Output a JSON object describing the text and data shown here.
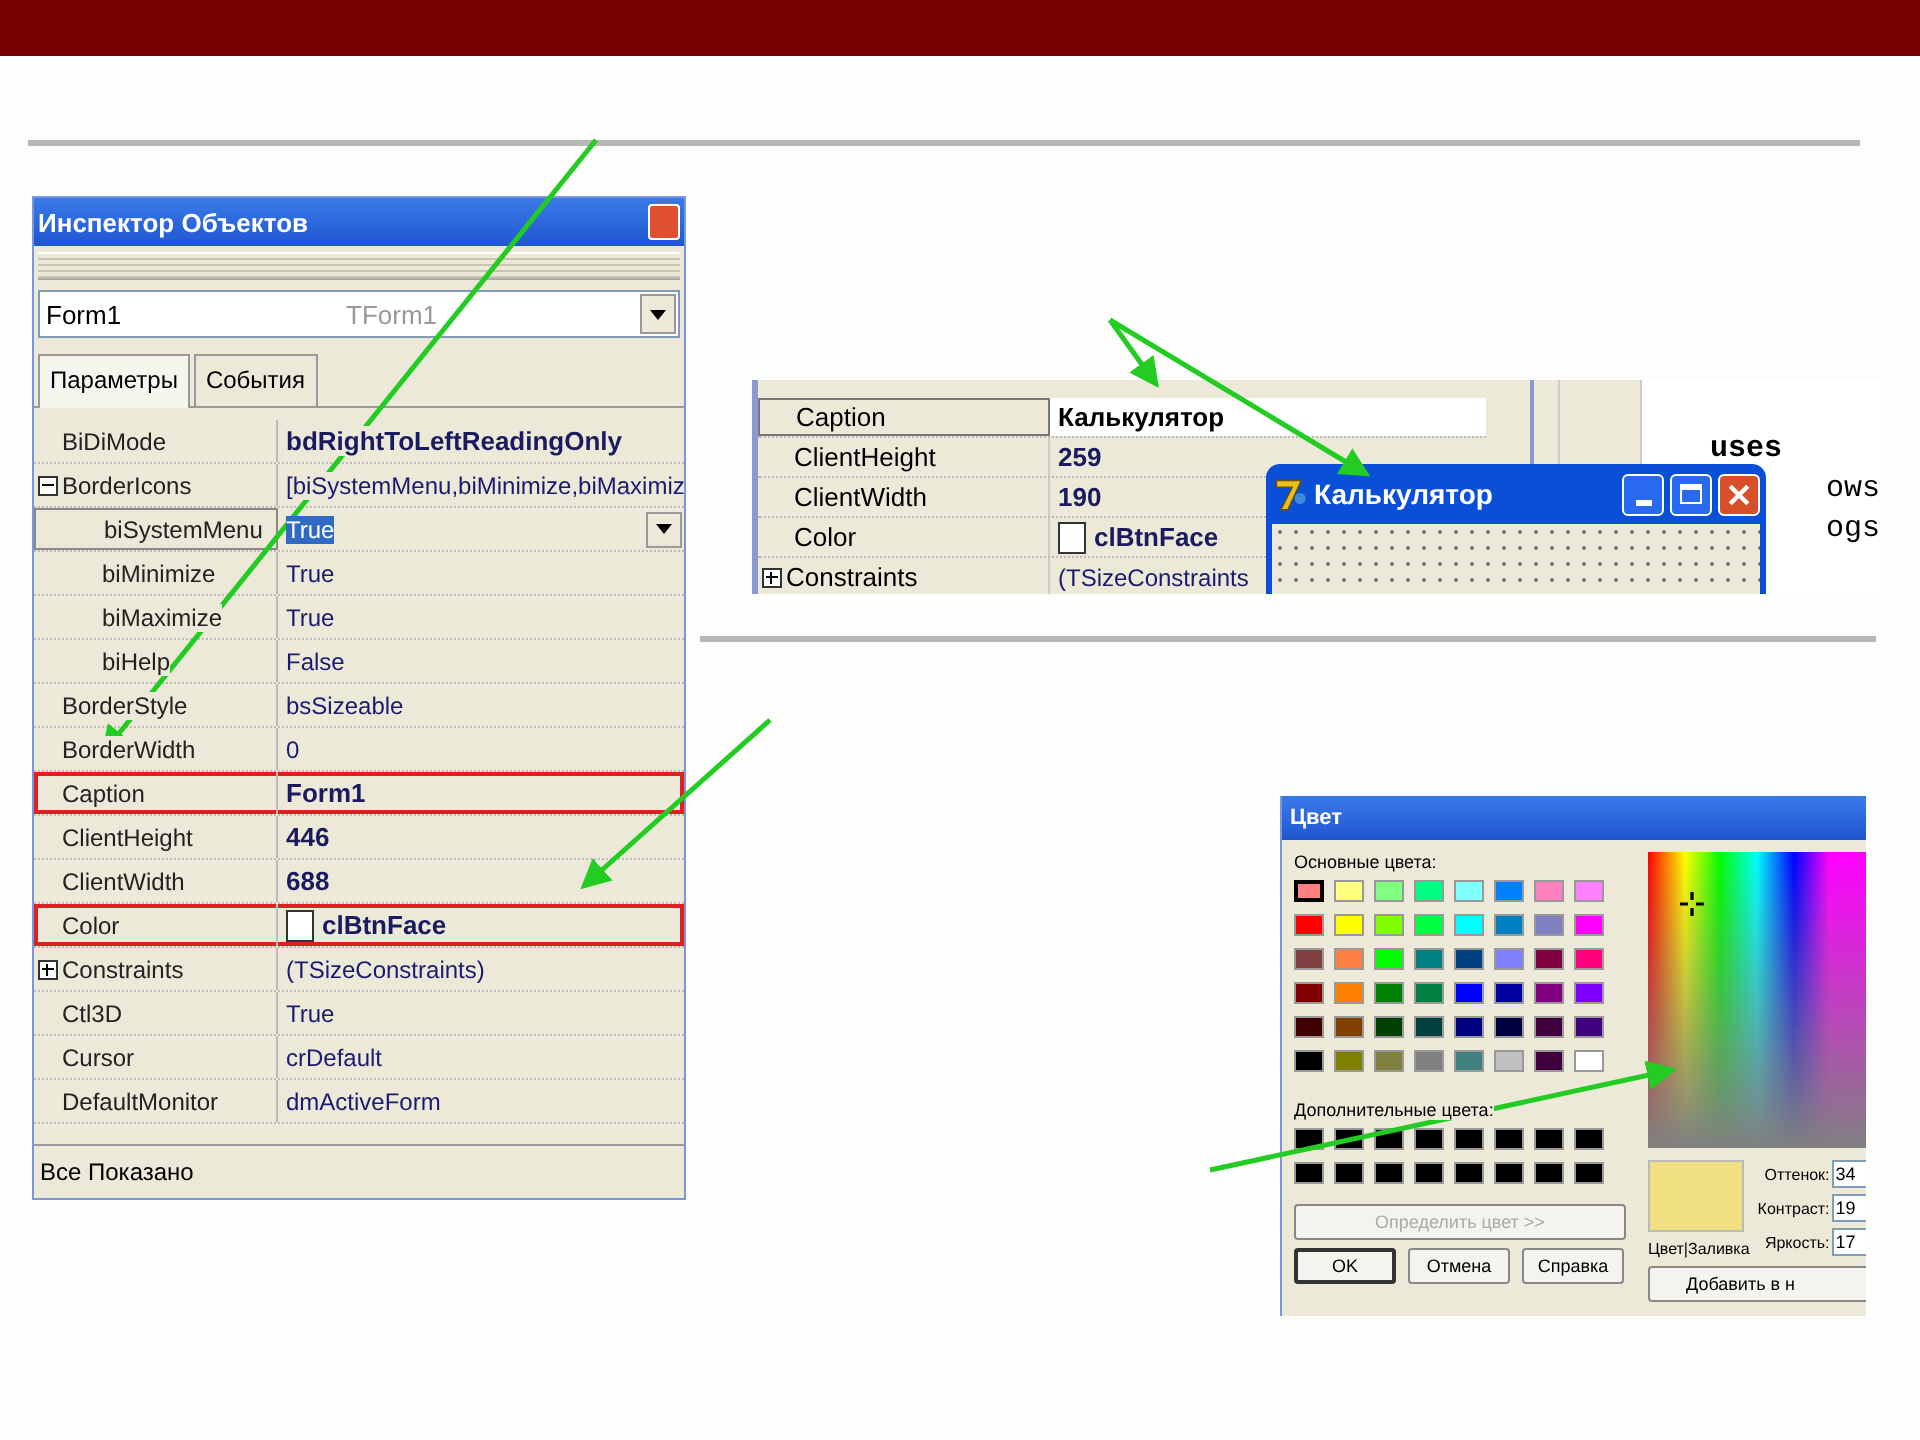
{
  "inspector": {
    "title": "Инспектор Объектов",
    "object_name": "Form1",
    "object_type": "TForm1",
    "tabs": [
      {
        "label": "Параметры",
        "selected": true
      },
      {
        "label": "События",
        "selected": false
      }
    ],
    "properties": [
      {
        "name": "BiDiMode",
        "value": "bdRightToLeftReadingOnly",
        "kind": "text",
        "bold": true,
        "selected": false,
        "highlighted": false
      },
      {
        "name": "BorderIcons",
        "value": "[biSystemMenu,biMinimize,biMaximiz",
        "kind": "text",
        "bold": false,
        "selected": false,
        "highlighted": false,
        "expanded": true,
        "children": [
          {
            "name": "biSystemMenu",
            "value": "True",
            "kind": "dropdown",
            "bold": false,
            "selected": true,
            "highlighted": false
          },
          {
            "name": "biMinimize",
            "value": "True",
            "kind": "text",
            "bold": false,
            "selected": false,
            "highlighted": false
          },
          {
            "name": "biMaximize",
            "value": "True",
            "kind": "text",
            "bold": false,
            "selected": false,
            "highlighted": false
          },
          {
            "name": "biHelp",
            "value": "False",
            "kind": "text",
            "bold": false,
            "selected": false,
            "highlighted": false
          }
        ]
      },
      {
        "name": "BorderStyle",
        "value": "bsSizeable",
        "kind": "text",
        "bold": false,
        "selected": false,
        "highlighted": false
      },
      {
        "name": "BorderWidth",
        "value": "0",
        "kind": "text",
        "bold": false,
        "selected": false,
        "highlighted": false
      },
      {
        "name": "Caption",
        "value": "Form1",
        "kind": "text",
        "bold": true,
        "selected": false,
        "highlighted": true
      },
      {
        "name": "ClientHeight",
        "value": "446",
        "kind": "text",
        "bold": true,
        "selected": false,
        "highlighted": false
      },
      {
        "name": "ClientWidth",
        "value": "688",
        "kind": "text",
        "bold": true,
        "selected": false,
        "highlighted": false
      },
      {
        "name": "Color",
        "value": "clBtnFace",
        "kind": "color",
        "bold": true,
        "selected": false,
        "highlighted": true
      },
      {
        "name": "Constraints",
        "value": "(TSizeConstraints)",
        "kind": "text",
        "bold": false,
        "selected": false,
        "highlighted": false,
        "expanded": false
      },
      {
        "name": "Ctl3D",
        "value": "True",
        "kind": "text",
        "bold": false,
        "selected": false,
        "highlighted": false
      },
      {
        "name": "Cursor",
        "value": "crDefault",
        "kind": "text",
        "bold": false,
        "selected": false,
        "highlighted": false
      },
      {
        "name": "DefaultMonitor",
        "value": "dmActiveForm",
        "kind": "text",
        "bold": false,
        "selected": false,
        "highlighted": false
      }
    ],
    "status": "Все Показано"
  },
  "caption_example": {
    "properties": [
      {
        "name": "Caption",
        "value": "Калькулятор",
        "kind": "text",
        "bold": true,
        "selected": true
      },
      {
        "name": "ClientHeight",
        "value": "259",
        "kind": "text",
        "bold": true,
        "selected": false
      },
      {
        "name": "ClientWidth",
        "value": "190",
        "kind": "text",
        "bold": true,
        "selected": false
      },
      {
        "name": "Color",
        "value": "clBtnFace",
        "kind": "color",
        "bold": true,
        "selected": false
      },
      {
        "name": "Constraints",
        "value": "(TSizeConstraints",
        "kind": "text",
        "bold": false,
        "selected": false,
        "expanded": false
      }
    ],
    "code_lines": [
      "uses",
      "ows",
      "ogs"
    ],
    "form_window": {
      "title": "Калькулятор"
    }
  },
  "color_dialog": {
    "title": "Цвет",
    "basic_label": "Основные цвета:",
    "basic_colors": [
      {
        "color": "#ff8080",
        "selected": true
      },
      {
        "color": "#ffff80",
        "selected": false
      },
      {
        "color": "#80ff80",
        "selected": false
      },
      {
        "color": "#00ff80",
        "selected": false
      },
      {
        "color": "#80ffff",
        "selected": false
      },
      {
        "color": "#0080ff",
        "selected": false
      },
      {
        "color": "#ff80c0",
        "selected": false
      },
      {
        "color": "#ff80ff",
        "selected": false
      },
      {
        "color": "#ff0000",
        "selected": false
      },
      {
        "color": "#ffff00",
        "selected": false
      },
      {
        "color": "#80ff00",
        "selected": false
      },
      {
        "color": "#00ff40",
        "selected": false
      },
      {
        "color": "#00ffff",
        "selected": false
      },
      {
        "color": "#0080c0",
        "selected": false
      },
      {
        "color": "#8080c0",
        "selected": false
      },
      {
        "color": "#ff00ff",
        "selected": false
      },
      {
        "color": "#804040",
        "selected": false
      },
      {
        "color": "#ff8040",
        "selected": false
      },
      {
        "color": "#00ff00",
        "selected": false
      },
      {
        "color": "#008080",
        "selected": false
      },
      {
        "color": "#004080",
        "selected": false
      },
      {
        "color": "#8080ff",
        "selected": false
      },
      {
        "color": "#800040",
        "selected": false
      },
      {
        "color": "#ff0080",
        "selected": false
      },
      {
        "color": "#800000",
        "selected": false
      },
      {
        "color": "#ff8000",
        "selected": false
      },
      {
        "color": "#008000",
        "selected": false
      },
      {
        "color": "#008040",
        "selected": false
      },
      {
        "color": "#0000ff",
        "selected": false
      },
      {
        "color": "#0000a0",
        "selected": false
      },
      {
        "color": "#800080",
        "selected": false
      },
      {
        "color": "#8000ff",
        "selected": false
      },
      {
        "color": "#400000",
        "selected": false
      },
      {
        "color": "#804000",
        "selected": false
      },
      {
        "color": "#004000",
        "selected": false
      },
      {
        "color": "#004040",
        "selected": false
      },
      {
        "color": "#000080",
        "selected": false
      },
      {
        "color": "#000040",
        "selected": false
      },
      {
        "color": "#400040",
        "selected": false
      },
      {
        "color": "#400080",
        "selected": false
      },
      {
        "color": "#000000",
        "selected": false
      },
      {
        "color": "#808000",
        "selected": false
      },
      {
        "color": "#808040",
        "selected": false
      },
      {
        "color": "#808080",
        "selected": false
      },
      {
        "color": "#408080",
        "selected": false
      },
      {
        "color": "#c0c0c0",
        "selected": false
      },
      {
        "color": "#400040",
        "selected": false
      },
      {
        "color": "#ffffff",
        "selected": false
      }
    ],
    "custom_label": "Дополнительные цвета:",
    "custom_colors": [
      {
        "color": "#000000"
      },
      {
        "color": "#000000"
      },
      {
        "color": "#000000"
      },
      {
        "color": "#000000"
      },
      {
        "color": "#000000"
      },
      {
        "color": "#000000"
      },
      {
        "color": "#000000"
      },
      {
        "color": "#000000"
      },
      {
        "color": "#000000"
      },
      {
        "color": "#000000"
      },
      {
        "color": "#000000"
      },
      {
        "color": "#000000"
      },
      {
        "color": "#000000"
      },
      {
        "color": "#000000"
      },
      {
        "color": "#000000"
      },
      {
        "color": "#000000"
      }
    ],
    "define_button": {
      "label": "Определить цвет >>",
      "disabled": true
    },
    "preview_label": "Цвет|Заливка",
    "fields": [
      {
        "label": "Оттенок:",
        "value": "34"
      },
      {
        "label": "Контраст:",
        "value": "19"
      },
      {
        "label": "Яркость:",
        "value": "17"
      }
    ],
    "buttons": [
      "OK",
      "Отмена",
      "Справка"
    ],
    "add_button": "Добавить в н"
  }
}
